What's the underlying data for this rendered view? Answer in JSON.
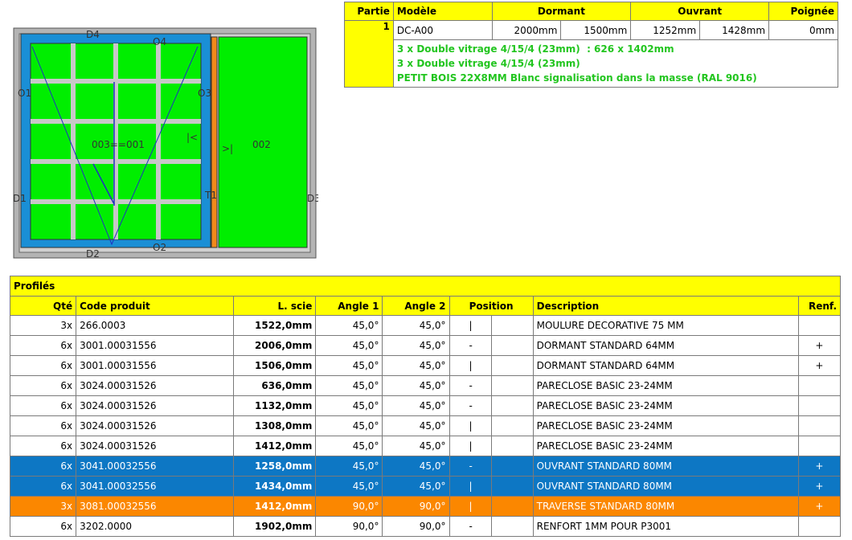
{
  "spec": {
    "headers": {
      "partie": "Partie",
      "modele": "Modèle",
      "dormant": "Dormant",
      "ouvrant": "Ouvrant",
      "poignee": "Poignée"
    },
    "row": {
      "partie": "1",
      "modele": "DC-A00",
      "dormant_w": "2000mm",
      "dormant_h": "1500mm",
      "ouvrant_w": "1252mm",
      "ouvrant_h": "1428mm",
      "poignee": "0mm"
    },
    "notes": [
      "3 x Double vitrage 4/15/4 (23mm)  : 626 x 1402mm",
      "3 x Double vitrage 4/15/4 (23mm)",
      "PETIT BOIS 22X8MM Blanc signalisation dans la masse (RAL 9016)"
    ]
  },
  "drawing": {
    "labels": {
      "d4": "D4",
      "d2": "D2",
      "o4": "O4",
      "o2": "O2",
      "o1": "O1",
      "o3": "O3",
      "d1": "D1",
      "d3": "D3",
      "t1": "T1",
      "sash": "003==001",
      "fixed": "002",
      "arrow_left": "|<",
      "arrow_right": ">|"
    },
    "colors": {
      "glass": "#00ee00",
      "frame": "#b4b4b4",
      "sash": "#1a8fd6",
      "bar": "#c8c8c8",
      "transom": "#f28a1a"
    }
  },
  "profiles": {
    "title": "Profilés",
    "columns": {
      "qte": "Qté",
      "code": "Code produit",
      "lscie": "L. scie",
      "angle1": "Angle 1",
      "angle2": "Angle 2",
      "position": "Position",
      "description": "Description",
      "renf": "Renf."
    },
    "rows": [
      {
        "qte": "3x",
        "code": "266.0003",
        "lscie": "1522,0mm",
        "a1": "45,0°",
        "a2": "45,0°",
        "pos": "|",
        "desc": "MOULURE DECORATIVE 75 MM",
        "renf": "",
        "style": "normal"
      },
      {
        "qte": "6x",
        "code": "3001.00031556",
        "lscie": "2006,0mm",
        "a1": "45,0°",
        "a2": "45,0°",
        "pos": "-",
        "desc": "DORMANT STANDARD 64MM",
        "renf": "+",
        "style": "normal"
      },
      {
        "qte": "6x",
        "code": "3001.00031556",
        "lscie": "1506,0mm",
        "a1": "45,0°",
        "a2": "45,0°",
        "pos": "|",
        "desc": "DORMANT STANDARD 64MM",
        "renf": "+",
        "style": "normal"
      },
      {
        "qte": "6x",
        "code": "3024.00031526",
        "lscie": "636,0mm",
        "a1": "45,0°",
        "a2": "45,0°",
        "pos": "-",
        "desc": "PARECLOSE BASIC 23-24MM",
        "renf": "",
        "style": "normal"
      },
      {
        "qte": "6x",
        "code": "3024.00031526",
        "lscie": "1132,0mm",
        "a1": "45,0°",
        "a2": "45,0°",
        "pos": "-",
        "desc": "PARECLOSE BASIC 23-24MM",
        "renf": "",
        "style": "normal"
      },
      {
        "qte": "6x",
        "code": "3024.00031526",
        "lscie": "1308,0mm",
        "a1": "45,0°",
        "a2": "45,0°",
        "pos": "|",
        "desc": "PARECLOSE BASIC 23-24MM",
        "renf": "",
        "style": "normal"
      },
      {
        "qte": "6x",
        "code": "3024.00031526",
        "lscie": "1412,0mm",
        "a1": "45,0°",
        "a2": "45,0°",
        "pos": "|",
        "desc": "PARECLOSE BASIC 23-24MM",
        "renf": "",
        "style": "normal"
      },
      {
        "qte": "6x",
        "code": "3041.00032556",
        "lscie": "1258,0mm",
        "a1": "45,0°",
        "a2": "45,0°",
        "pos": "-",
        "desc": "OUVRANT STANDARD 80MM",
        "renf": "+",
        "style": "blue"
      },
      {
        "qte": "6x",
        "code": "3041.00032556",
        "lscie": "1434,0mm",
        "a1": "45,0°",
        "a2": "45,0°",
        "pos": "|",
        "desc": "OUVRANT STANDARD 80MM",
        "renf": "+",
        "style": "blue"
      },
      {
        "qte": "3x",
        "code": "3081.00032556",
        "lscie": "1412,0mm",
        "a1": "90,0°",
        "a2": "90,0°",
        "pos": "|",
        "desc": "TRAVERSE STANDARD 80MM",
        "renf": "+",
        "style": "orange"
      },
      {
        "qte": "6x",
        "code": "3202.0000",
        "lscie": "1902,0mm",
        "a1": "90,0°",
        "a2": "90,0°",
        "pos": "-",
        "desc": "RENFORT 1MM POUR P3001",
        "renf": "",
        "style": "normal"
      }
    ]
  }
}
